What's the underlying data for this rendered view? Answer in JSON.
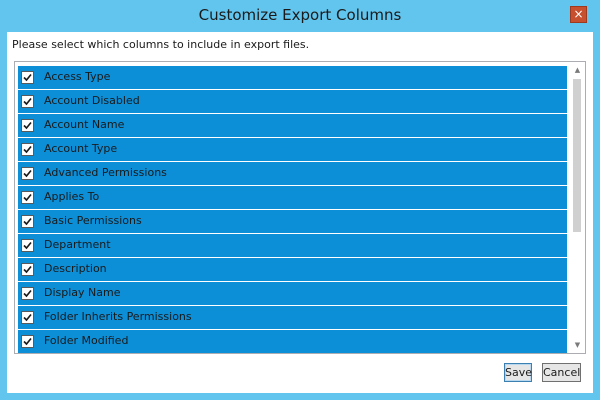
{
  "window": {
    "title": "Customize Export Columns",
    "close_glyph": "×",
    "accent_color": "#62c5ee",
    "close_color": "#c7502f"
  },
  "dialog": {
    "prompt": "Please select which columns to include in export files.",
    "selection_color": "#0d8fd8",
    "columns": [
      {
        "label": "Access Type",
        "checked": true
      },
      {
        "label": "Account Disabled",
        "checked": true
      },
      {
        "label": "Account Name",
        "checked": true
      },
      {
        "label": "Account Type",
        "checked": true
      },
      {
        "label": "Advanced Permissions",
        "checked": true
      },
      {
        "label": "Applies To",
        "checked": true
      },
      {
        "label": "Basic Permissions",
        "checked": true
      },
      {
        "label": "Department",
        "checked": true
      },
      {
        "label": "Description",
        "checked": true
      },
      {
        "label": "Display Name",
        "checked": true
      },
      {
        "label": "Folder Inherits Permissions",
        "checked": true
      },
      {
        "label": "Folder Modified",
        "checked": true
      }
    ],
    "scroll": {
      "up_glyph": "▲",
      "down_glyph": "▼"
    }
  },
  "buttons": {
    "save_label": "Save",
    "cancel_label": "Cancel"
  },
  "icons": {
    "close": "close-icon",
    "check": "checkmark-icon",
    "scroll_up": "scroll-up-arrow-icon",
    "scroll_down": "scroll-down-arrow-icon"
  }
}
